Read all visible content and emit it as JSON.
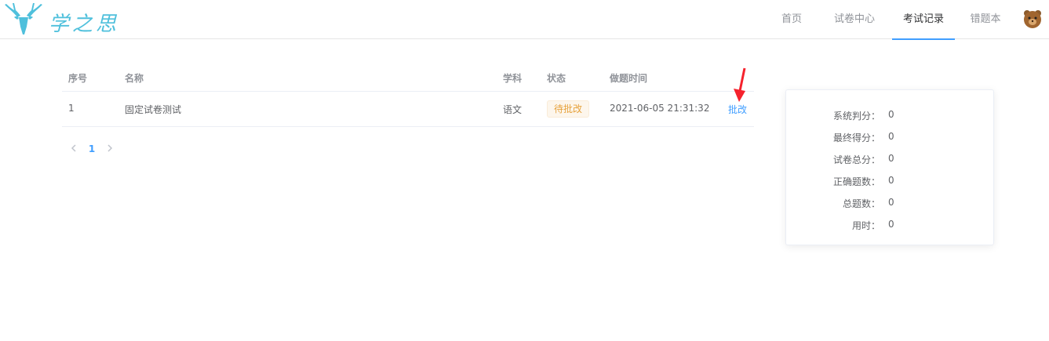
{
  "header": {
    "logo_text": "学之思",
    "nav": [
      {
        "label": "首页",
        "active": false
      },
      {
        "label": "试卷中心",
        "active": false
      },
      {
        "label": "考试记录",
        "active": true
      },
      {
        "label": "错题本",
        "active": false
      }
    ],
    "accent": "#409eff"
  },
  "table": {
    "columns": {
      "index": "序号",
      "name": "名称",
      "subject": "学科",
      "status": "状态",
      "time": "做题时间"
    },
    "rows": [
      {
        "index": "1",
        "name": "固定试卷测试",
        "subject": "语文",
        "status": "待批改",
        "time": "2021-06-05 21:31:32",
        "action": "批改"
      }
    ]
  },
  "pagination": {
    "current": "1",
    "prev_icon": "chevron-left-icon",
    "next_icon": "chevron-right-icon"
  },
  "score_card": {
    "items": [
      {
        "label": "系统判分：",
        "value": "0"
      },
      {
        "label": "最终得分：",
        "value": "0"
      },
      {
        "label": "试卷总分：",
        "value": "0"
      },
      {
        "label": "正确题数：",
        "value": "0"
      },
      {
        "label": "总题数：",
        "value": "0"
      },
      {
        "label": "用时：",
        "value": "0"
      }
    ]
  },
  "colors": {
    "status_warning": "#e6a23c",
    "link": "#409eff",
    "annotation_arrow": "#f5222d"
  }
}
